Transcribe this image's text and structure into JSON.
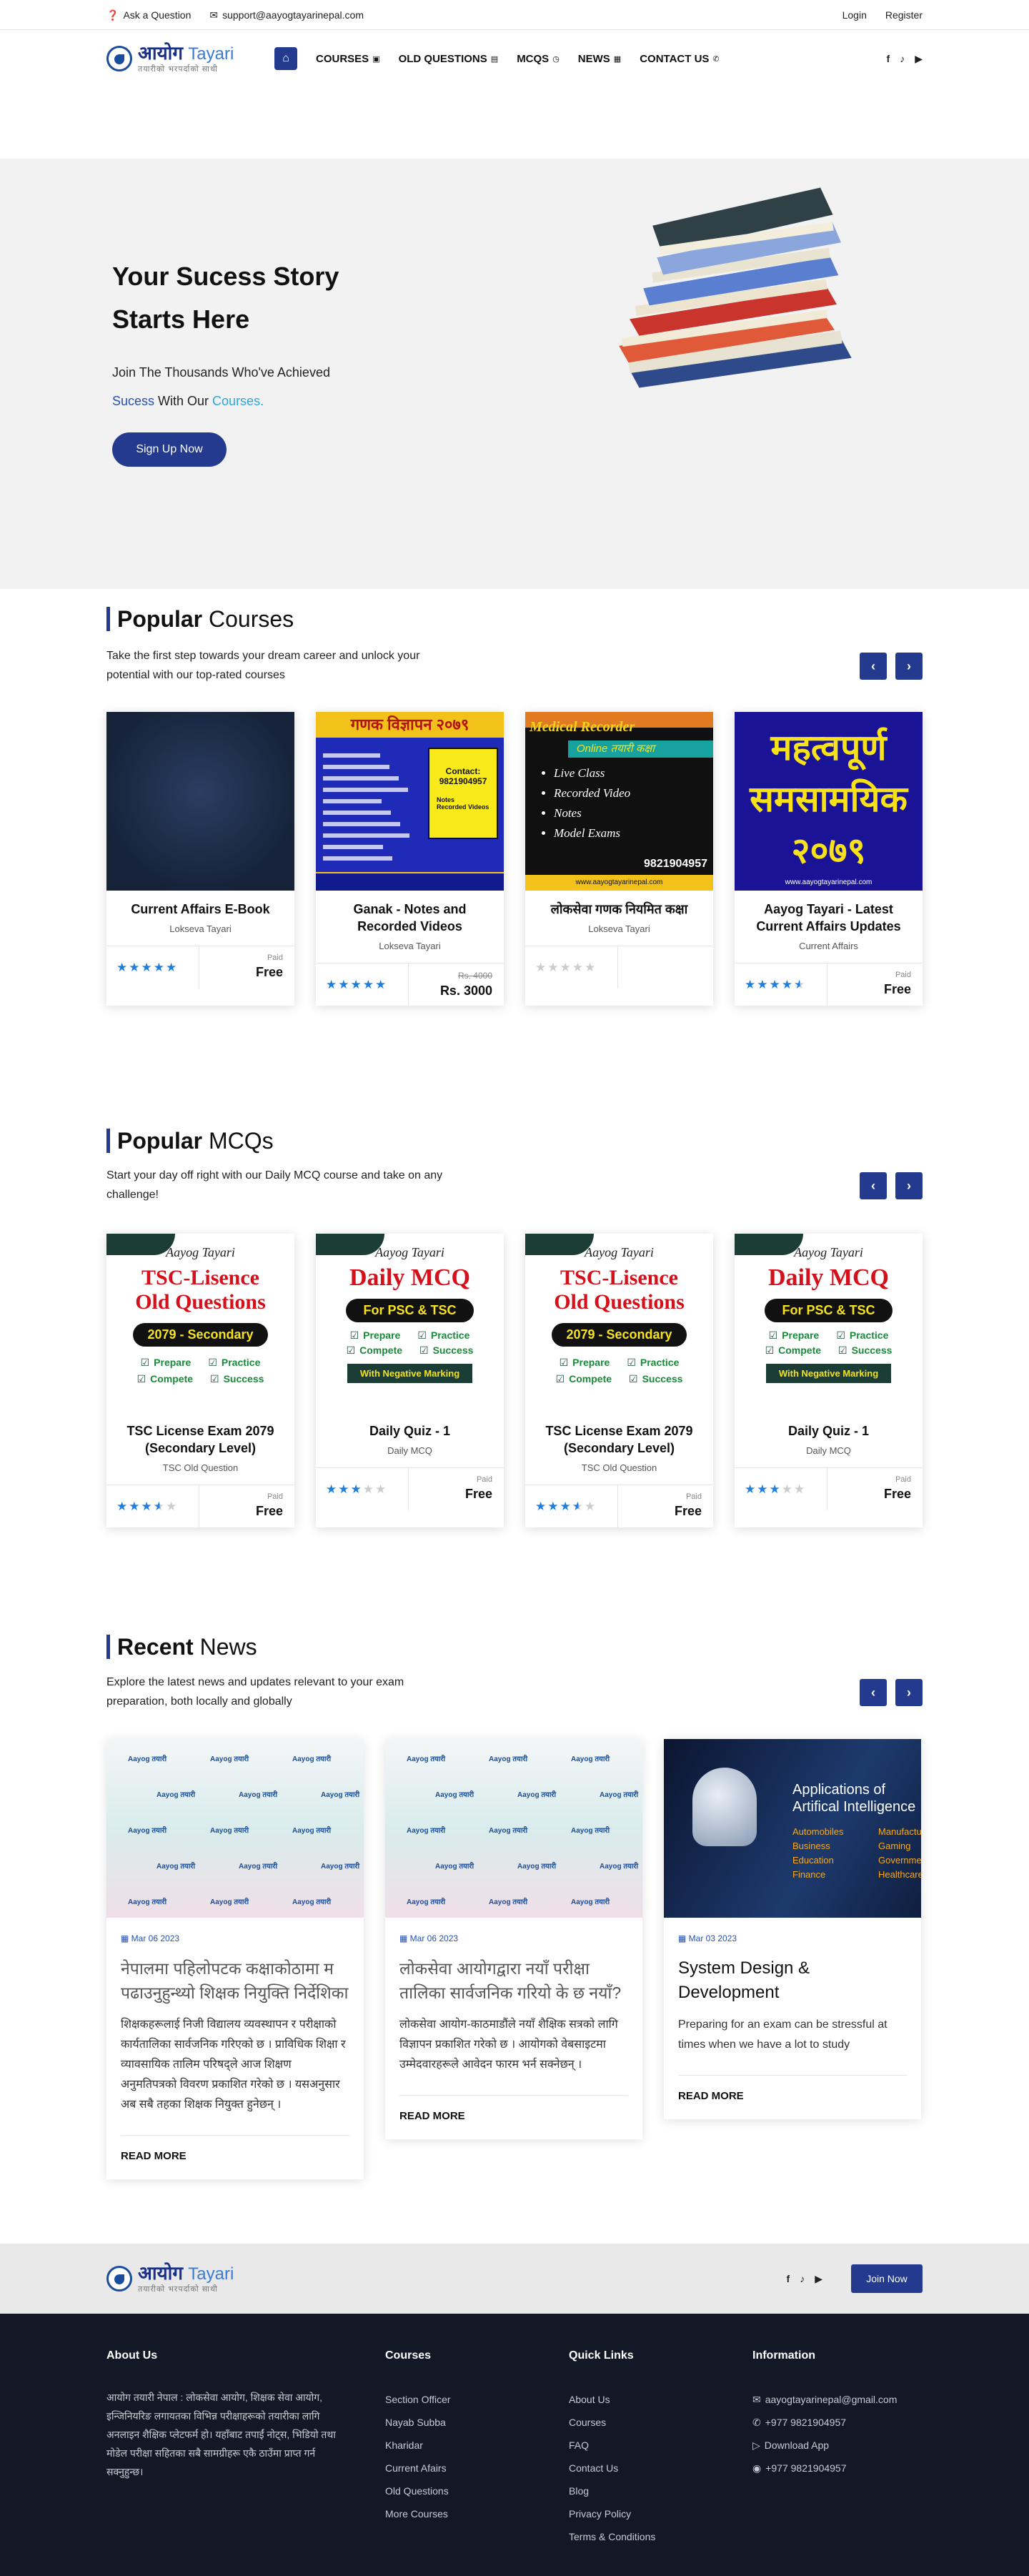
{
  "topbar": {
    "ask": "Ask a Question",
    "email": "support@aayogtayarinepal.com",
    "login": "Login",
    "register": "Register"
  },
  "logo": {
    "main": "आयोग",
    "accent": "Tayari",
    "tagline": "तयारीको भरपर्दाको साथी"
  },
  "nav": {
    "items": [
      {
        "label": "COURSES",
        "icon": "book-icon"
      },
      {
        "label": "OLD QUESTIONS",
        "icon": "file-icon"
      },
      {
        "label": "MCQS",
        "icon": "clock-icon"
      },
      {
        "label": "NEWS",
        "icon": "newspaper-icon"
      },
      {
        "label": "CONTACT US",
        "icon": "phone-icon"
      }
    ]
  },
  "hero": {
    "title": "Your Sucess Story Starts Here",
    "line1": "Join The Thousands Who've Achieved",
    "w_sucess": "Sucess",
    "w_with": " With Our ",
    "w_courses": "Courses.",
    "button": "Sign Up Now"
  },
  "courses": {
    "title_bold": "Popular",
    "title_rest": " Courses",
    "desc": "Take the first step towards your dream career and unlock your potential with our top-rated courses",
    "items": [
      {
        "title": "Current Affairs E-Book",
        "cat": "Lokseva Tayari",
        "stars": 5,
        "label": "Paid",
        "price": "Free",
        "old": ""
      },
      {
        "title": "Ganak - Notes and Recorded Videos",
        "cat": "Lokseva Tayari",
        "stars": 5,
        "label": "",
        "price": "Rs. 3000",
        "old": "Rs. 4000"
      },
      {
        "title": "लोकसेवा गणक  नियमित कक्षा",
        "cat": "Lokseva Tayari",
        "stars": 0,
        "label": "",
        "price": "",
        "old": ""
      },
      {
        "title": "Aayog Tayari - Latest Current Affairs Updates",
        "cat": "Current Affairs",
        "stars": 4.5,
        "label": "Paid",
        "price": "Free",
        "old": ""
      }
    ]
  },
  "thumbs": {
    "ganak_head": "गणक विज्ञापन २०७९",
    "ganak_contact": "Contact:",
    "ganak_phone": "9821904957",
    "ganak_notes": "Notes",
    "ganak_videos": "Recorded Videos",
    "rec_title": "Medical Recorder",
    "rec_online": "Online तयारी कक्षा",
    "rec_list": [
      "Live Class",
      "Recorded Video",
      "Notes",
      "Model Exams"
    ],
    "rec_phone": "9821904957",
    "rec_site": "www.aayogtayarinepal.com",
    "ca_text": "महत्वपूर्ण समसामयिक २०७९",
    "ca_site": "www.aayogtayarinepal.com"
  },
  "mcqs": {
    "title_bold": "Popular",
    "title_rest": " MCQs",
    "desc": "Start your day off right with our Daily MCQ course and take on any challenge!",
    "items": [
      {
        "type": "tsc",
        "title": "TSC License Exam 2079 (Secondary Level)",
        "cat": "TSC Old Question",
        "stars": 3.5,
        "label": "Paid",
        "price": "Free"
      },
      {
        "type": "daily",
        "title": "Daily Quiz - 1",
        "cat": "Daily MCQ",
        "stars": 3,
        "label": "Paid",
        "price": "Free"
      },
      {
        "type": "tsc",
        "title": "TSC License Exam 2079 (Secondary Level)",
        "cat": "TSC Old Question",
        "stars": 3.5,
        "label": "Paid",
        "price": "Free"
      },
      {
        "type": "daily",
        "title": "Daily Quiz - 1",
        "cat": "Daily MCQ",
        "stars": 3,
        "label": "Paid",
        "price": "Free"
      }
    ],
    "thumb": {
      "brand": "Aayog Tayari",
      "tsc1": "TSC-Lisence",
      "tsc2": "Old Questions",
      "tsc3": "2079 - Secondary",
      "d1": "Daily MCQ",
      "d2": "For PSC & TSC",
      "neg": "With Negative Marking",
      "p": "Prepare",
      "pr": "Practice",
      "c": "Compete",
      "s": "Success"
    }
  },
  "news": {
    "title_bold": "Recent",
    "title_rest": " News",
    "desc": "Explore the latest news and updates relevant to your exam preparation, both locally and globally",
    "wm": "Aayog तयारी",
    "ai": {
      "h1": "Applications of",
      "h2": "Artifical Intelligence",
      "l": [
        "Automobiles",
        "Business",
        "Education",
        "Finance"
      ],
      "r": [
        "Manufacturing",
        "Gaming",
        "Government",
        "Healthcare"
      ]
    },
    "items": [
      {
        "date": "Mar 06 2023",
        "title": "नेपालमा पहिलोपटक कक्षाकोठामा म पढाउनुहुन्थ्यो शिक्षक नियुक्ति निर्देशिका",
        "text": "शिक्षकहरूलाई निजी विद्यालय व्यवस्थापन र परीक्षाको कार्यतालिका सार्वजनिक गरिएको छ । प्राविधिक शिक्षा र व्यावसायिक तालिम परिषद्ले आज शिक्षण अनुमतिपत्रको विवरण प्रकाशित गरेको छ । यसअनुसार अब सबै तहका शिक्षक नियुक्त हुनेछन् ।",
        "read": "READ MORE",
        "dark": false
      },
      {
        "date": "Mar 06 2023",
        "title": "लोकसेवा आयोगद्वारा नयाँ परीक्षा तालिका सार्वजनिक गरियो के छ नयाँ?",
        "text": "लोकसेवा आयोग-काठमाडौंले नयाँ शैक्षिक सत्रको लागि विज्ञापन प्रकाशित गरेको छ । आयोगको वेबसाइटमा उम्मेदवारहरूले आवेदन फारम भर्न सक्नेछन् ।",
        "read": "READ MORE",
        "dark": false
      },
      {
        "date": "Mar 03 2023",
        "title": "System Design & Development",
        "text": "Preparing for an exam can be stressful at times when we have a lot to study",
        "read": "READ MORE",
        "dark": true
      }
    ]
  },
  "footer_bar": {
    "join": "Join Now"
  },
  "footer": {
    "about_h": "About Us",
    "about": "आयोग तयारी नेपाल : लोकसेवा आयोग, शिक्षक सेवा आयोग, इन्जिनियरिङ लगायतका विभिन्न परीक्षाहरूको तयारीका लागि अनलाइन शैक्षिक प्लेटफर्म हो। यहाँबाट तपाईं नोट्स, भिडियो तथा मोडेल परीक्षा सहितका सबै सामग्रीहरू एकै ठाउँमा प्राप्त गर्न सक्नुहुन्छ।",
    "courses_h": "Courses",
    "courses": [
      "Section Officer",
      "Nayab Subba",
      "Kharidar",
      "Current Afairs",
      "Old Questions",
      "More Courses"
    ],
    "links_h": "Quick Links",
    "links": [
      "About Us",
      "Courses",
      "FAQ",
      "Contact Us",
      "Blog",
      "Privacy Policy",
      "Terms & Conditions"
    ],
    "info_h": "Information",
    "info": [
      {
        "icon": "mail-icon",
        "t": "aayogtayarinepal@gmail.com"
      },
      {
        "icon": "phone-icon",
        "t": "+977 9821904957"
      },
      {
        "icon": "play-icon",
        "t": "Download App"
      },
      {
        "icon": "whatsapp-icon",
        "t": "+977 9821904957"
      }
    ]
  },
  "colors": {
    "brand": "#243a8f",
    "accent": "#28a7e1",
    "star": "#1f7fe0",
    "footer": "#121826"
  }
}
